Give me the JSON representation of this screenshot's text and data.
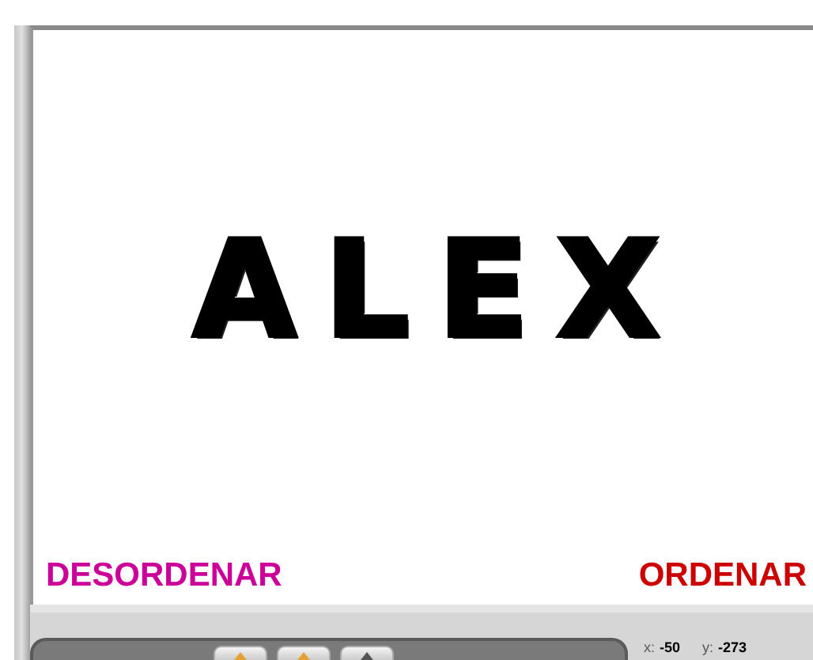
{
  "stage": {
    "sprites": [
      {
        "letter": "A"
      },
      {
        "letter": "L"
      },
      {
        "letter": "E"
      },
      {
        "letter": "X"
      }
    ],
    "buttons": [
      {
        "label": "DESORDENAR",
        "color": "#cc0099"
      },
      {
        "label": "ORDENAR",
        "color": "#cc0000"
      }
    ]
  },
  "status_bar": {
    "x_label": "x:",
    "x_value": "-50",
    "y_label": "y:",
    "y_value": "-273"
  }
}
